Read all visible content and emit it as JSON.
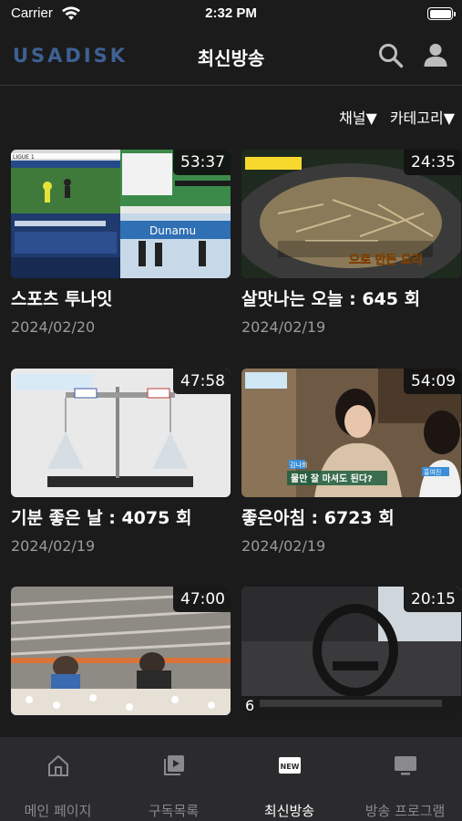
{
  "status_bar": {
    "carrier": "Carrier",
    "time": "2:32 PM"
  },
  "nav": {
    "logo": "USADISK",
    "title": "최신방송",
    "search_icon": "search-icon",
    "profile_icon": "person-icon"
  },
  "filters": {
    "channel": "채널▼",
    "category": "카테고리▼"
  },
  "videos": [
    {
      "title": "스포츠 투나잇",
      "date": "2024/02/20",
      "duration": "53:37"
    },
    {
      "title": "살맛나는 오늘 : 645 회",
      "date": "2024/02/19",
      "duration": "24:35"
    },
    {
      "title": "기분 좋은 날 : 4075 회",
      "date": "2024/02/19",
      "duration": "47:58"
    },
    {
      "title": "좋은아침 : 6723 회",
      "date": "2024/02/19",
      "duration": "54:09"
    },
    {
      "title": "",
      "date": "",
      "duration": "47:00"
    },
    {
      "title": "",
      "date": "",
      "duration": "20:15"
    }
  ],
  "thumb_text": {
    "v1_banner": "LIGUE 1",
    "v1_brand": "Dunamu",
    "v2_caption": "으로 만든 요리",
    "v4_name": "김나희",
    "v4_caption": "물만 잘 마셔도 된다?",
    "v4_name2": "홍여진",
    "v6_channel": "6"
  },
  "tabs": [
    {
      "label": "메인 페이지",
      "icon": "home-icon"
    },
    {
      "label": "구독목록",
      "icon": "play-library-icon"
    },
    {
      "label": "최신방송",
      "icon": "new-badge-icon",
      "active": true
    },
    {
      "label": "방송 프로그램",
      "icon": "tv-icon"
    }
  ],
  "colors": {
    "background": "#1b1b1c",
    "logo": "#3e6193",
    "tab_bar": "#2b2b2d",
    "inactive": "#8a8a8c"
  }
}
